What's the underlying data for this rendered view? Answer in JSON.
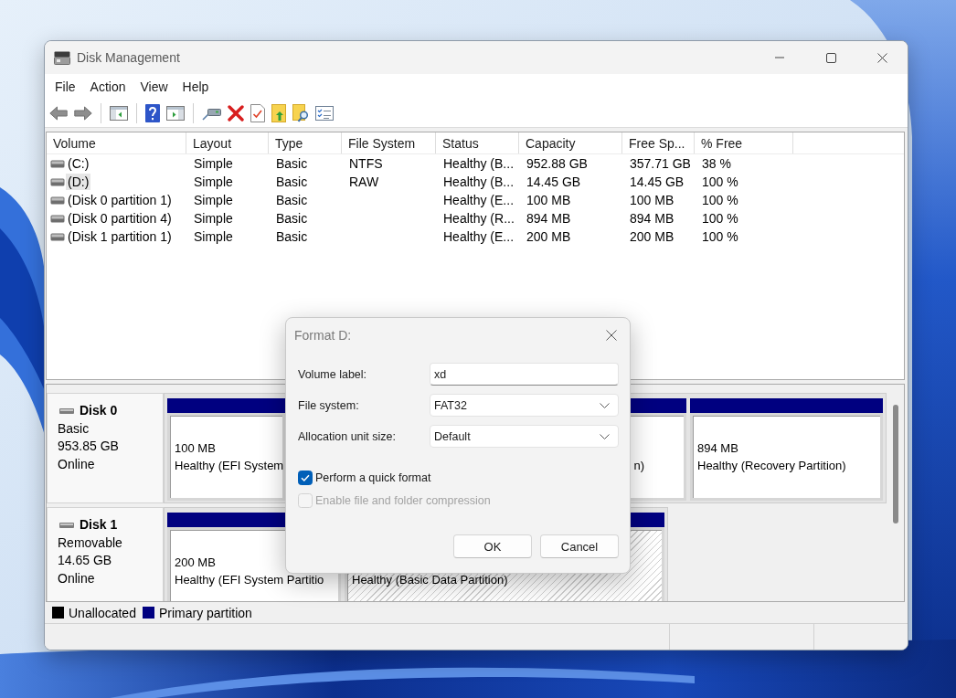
{
  "window": {
    "title": "Disk Management"
  },
  "menu": [
    "File",
    "Action",
    "View",
    "Help"
  ],
  "volume_table": {
    "columns": [
      "Volume",
      "Layout",
      "Type",
      "File System",
      "Status",
      "Capacity",
      "Free Sp...",
      "% Free"
    ],
    "rows": [
      {
        "volume": "(C:)",
        "layout": "Simple",
        "type": "Basic",
        "file_system": "NTFS",
        "status": "Healthy (B...",
        "capacity": "952.88 GB",
        "free_space": "357.71 GB",
        "percent_free": "38 %",
        "selected": false
      },
      {
        "volume": "(D:)",
        "layout": "Simple",
        "type": "Basic",
        "file_system": "RAW",
        "status": "Healthy (B...",
        "capacity": "14.45 GB",
        "free_space": "14.45 GB",
        "percent_free": "100 %",
        "selected": true
      },
      {
        "volume": "(Disk 0 partition 1)",
        "layout": "Simple",
        "type": "Basic",
        "status": "Healthy (E...",
        "capacity": "100 MB",
        "free_space": "100 MB",
        "percent_free": "100 %",
        "selected": false
      },
      {
        "volume": "(Disk 0 partition 4)",
        "layout": "Simple",
        "type": "Basic",
        "status": "Healthy (R...",
        "capacity": "894 MB",
        "free_space": "894 MB",
        "percent_free": "100 %",
        "selected": false
      },
      {
        "volume": "(Disk 1 partition 1)",
        "layout": "Simple",
        "type": "Basic",
        "status": "Healthy (E...",
        "capacity": "200 MB",
        "free_space": "200 MB",
        "percent_free": "100 %",
        "selected": false
      }
    ]
  },
  "disks": [
    {
      "name": "Disk 0",
      "type": "Basic",
      "size": "953.85 GB",
      "status": "Online",
      "partitions": [
        {
          "size": "100 MB",
          "status": "Healthy (EFI System",
          "selected": false
        },
        {
          "status": "n)",
          "selected": false
        },
        {
          "size": "894 MB",
          "status": "Healthy (Recovery Partition)",
          "selected": false
        }
      ]
    },
    {
      "name": "Disk 1",
      "type": "Removable",
      "size": "14.65 GB",
      "status": "Online",
      "partitions": [
        {
          "size": "200 MB",
          "status": "Healthy (EFI System Partitio",
          "selected": false
        },
        {
          "status": "Healthy (Basic Data Partition)",
          "selected": true
        }
      ]
    }
  ],
  "legend": [
    {
      "label": "Unallocated",
      "color": "#000000"
    },
    {
      "label": "Primary partition",
      "color": "#000080"
    }
  ],
  "dialog": {
    "title": "Format D:",
    "fields": [
      {
        "label": "Volume label:",
        "kind": "text",
        "value": "xd"
      },
      {
        "label": "File system:",
        "kind": "dropdown",
        "value": "FAT32"
      },
      {
        "label": "Allocation unit size:",
        "kind": "dropdown",
        "value": "Default"
      }
    ],
    "options": [
      {
        "label": "Perform a quick format",
        "checked": true,
        "disabled": false
      },
      {
        "label": "Enable file and folder compression",
        "checked": false,
        "disabled": true
      }
    ],
    "buttons": [
      "OK",
      "Cancel"
    ]
  }
}
